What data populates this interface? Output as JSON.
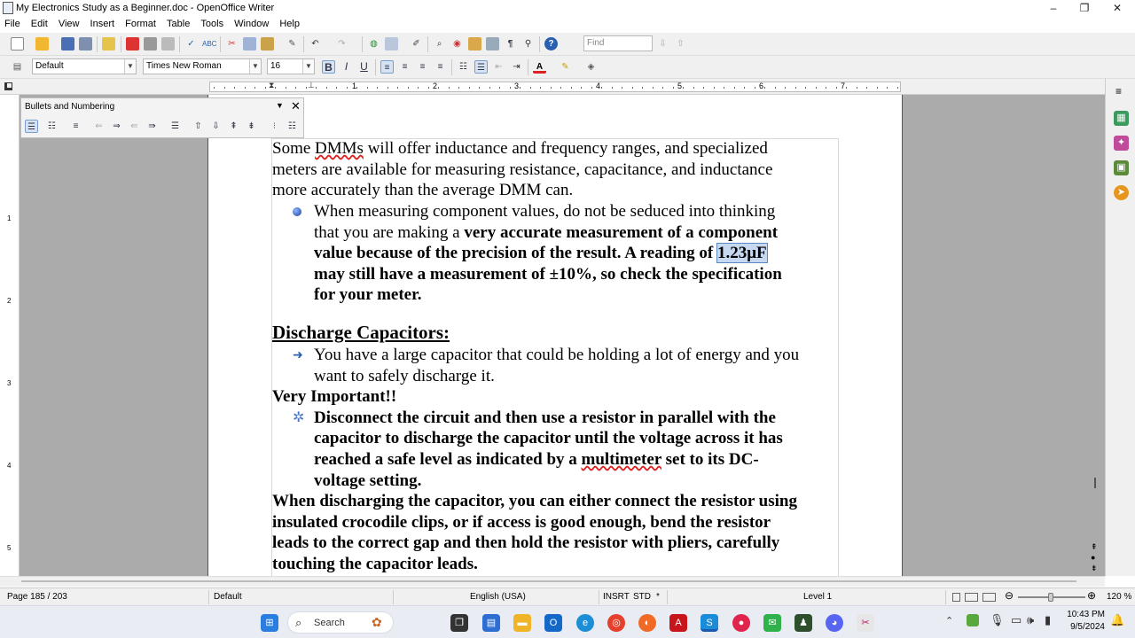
{
  "window": {
    "title": "My Electronics Study as a Beginner.doc - OpenOffice Writer",
    "minimize": "–",
    "maximize": "❐",
    "close": "✕"
  },
  "menu": [
    "File",
    "Edit",
    "View",
    "Insert",
    "Format",
    "Table",
    "Tools",
    "Window",
    "Help"
  ],
  "toolbar": {
    "find_placeholder": "Find",
    "style_value": "Default",
    "font_value": "Times New Roman",
    "size_value": "16",
    "bold": "B",
    "italic": "I",
    "underline": "U",
    "font_color_glyph": "A"
  },
  "ruler": {
    "numbers": [
      "1",
      "2",
      "3",
      "4",
      "5",
      "6",
      "7"
    ],
    "vertical_numbers": [
      "1",
      "2",
      "3",
      "4",
      "5"
    ]
  },
  "bullets_panel": {
    "title": "Bullets and Numbering"
  },
  "document": {
    "para1": [
      "Some DMMs will offer inductance and frequency ranges, and specialized",
      "meters are available for measuring resistance, capacitance, and inductance",
      "more accurately than the average DMM can."
    ],
    "bullet1_l1": "When measuring component values, do not be seduced into thinking",
    "bullet1_l2_normal": "that you are making a ",
    "bullet1_l2_bold": "very accurate measurement of a component",
    "bullet1_l3_bold": "value because of the precision of the result. A reading of ",
    "bullet1_l3_selected": "1.23μF",
    "bullet1_l4_bold": "may still have a measurement of ±10%, so check the specification",
    "bullet1_l5_bold": "for your meter.",
    "heading": "Discharge Capacitors:",
    "bullet2": [
      "You have a large capacitor that could be holding a lot of energy and you",
      "want to safely discharge it."
    ],
    "very_important": "Very Important!!",
    "bullet3_l1": "Disconnect the circuit and then use a resistor in parallel with the",
    "bullet3_l2": "capacitor to discharge the capacitor until the voltage across it has",
    "bullet3_l3_a": "reached a safe level as indicated by a ",
    "bullet3_l3_b": "multimeter",
    "bullet3_l3_c": " set to its DC-",
    "bullet3_l4": "voltage setting.",
    "para_last": [
      "When discharging the capacitor, you can either connect the resistor using",
      "insulated crocodile clips, or if access is good enough, bend the resistor",
      "leads to the correct gap and then hold the resistor with pliers, carefully",
      "touching the capacitor leads."
    ]
  },
  "status": {
    "page": "Page 185 / 203",
    "style": "Default",
    "language": "English (USA)",
    "insert_mode": "INSRT",
    "selection_mode": "STD",
    "modified": "*",
    "level": "Level 1",
    "zoom": "120 %"
  },
  "taskbar": {
    "search_label": "Search",
    "time": "10:43 PM",
    "date": "9/5/2024"
  },
  "colors": {
    "accent": "#2a5fb0",
    "selection": "#c6d9f1",
    "workspace": "#ababab"
  }
}
